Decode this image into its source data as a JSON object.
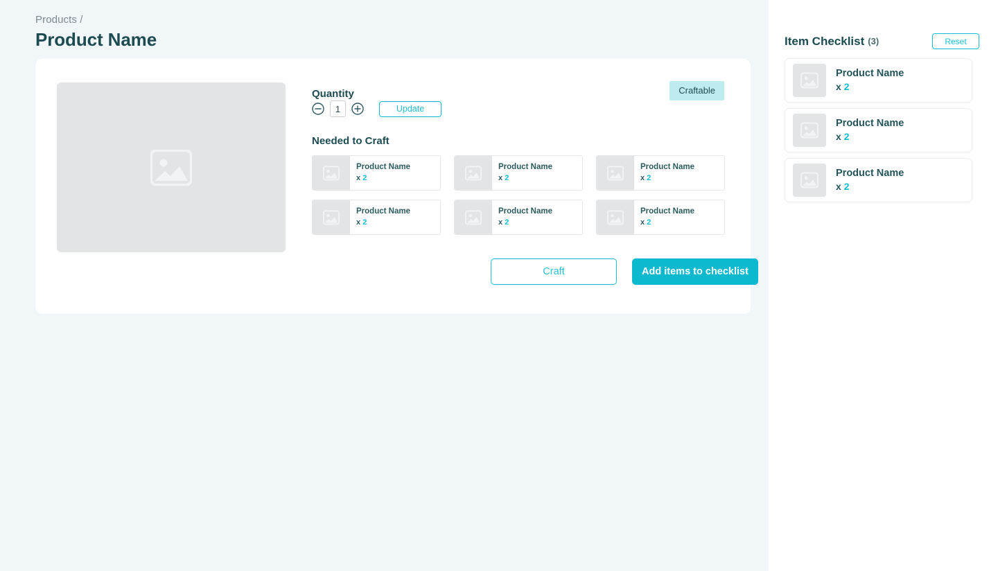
{
  "breadcrumb": "Products /",
  "page_title": "Product Name",
  "colors": {
    "page_background": "#f1f6f9",
    "panel_background": "#ffffff",
    "accent_cyan": "#0cb9cf",
    "heading_teal": "#1c4c51",
    "badge_background": "#bdecee",
    "placeholder_gray": "#e3e4e6"
  },
  "product": {
    "image_icon": "image-placeholder-icon",
    "quantity_label": "Quantity",
    "quantity_value": "1",
    "decrement_icon": "minus-circle-icon",
    "increment_icon": "plus-circle-icon",
    "update_label": "Update",
    "status_badge": "Craftable",
    "needed_label": "Needed to Craft",
    "ingredients": [
      {
        "name": "Product Name",
        "qty_prefix": "x",
        "qty": "2",
        "icon": "image-placeholder-icon"
      },
      {
        "name": "Product Name",
        "qty_prefix": "x",
        "qty": "2",
        "icon": "image-placeholder-icon"
      },
      {
        "name": "Product Name",
        "qty_prefix": "x",
        "qty": "2",
        "icon": "image-placeholder-icon"
      },
      {
        "name": "Product Name",
        "qty_prefix": "x",
        "qty": "2",
        "icon": "image-placeholder-icon"
      },
      {
        "name": "Product Name",
        "qty_prefix": "x",
        "qty": "2",
        "icon": "image-placeholder-icon"
      },
      {
        "name": "Product Name",
        "qty_prefix": "x",
        "qty": "2",
        "icon": "image-placeholder-icon"
      }
    ],
    "craft_label": "Craft",
    "add_to_checklist_label": "Add items to checklist"
  },
  "checklist": {
    "title": "Item Checklist",
    "count": "(3)",
    "reset_label": "Reset",
    "items": [
      {
        "name": "Product Name",
        "qty_prefix": "x",
        "qty": "2",
        "icon": "image-placeholder-icon"
      },
      {
        "name": "Product Name",
        "qty_prefix": "x",
        "qty": "2",
        "icon": "image-placeholder-icon"
      },
      {
        "name": "Product Name",
        "qty_prefix": "x",
        "qty": "2",
        "icon": "image-placeholder-icon"
      }
    ]
  }
}
